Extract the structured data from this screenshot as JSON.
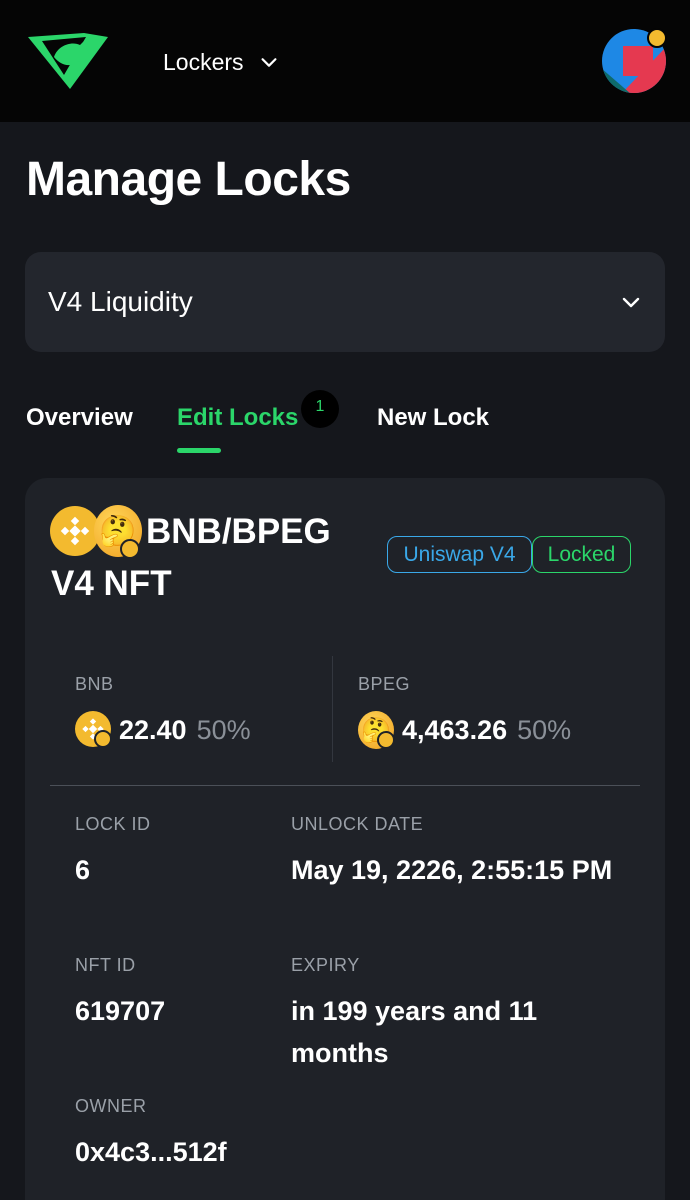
{
  "nav": {
    "dropdown_label": "Lockers"
  },
  "page": {
    "title": "Manage Locks"
  },
  "lock_type_select": {
    "value": "V4 Liquidity"
  },
  "tabs": [
    {
      "label": "Overview",
      "active": false
    },
    {
      "label": "Edit Locks",
      "active": true,
      "count": "1"
    },
    {
      "label": "New Lock",
      "active": false
    }
  ],
  "lock_card": {
    "pair": "BNB/BPEG",
    "subtitle": "V4 NFT",
    "badges": {
      "protocol": "Uniswap V4",
      "status": "Locked"
    },
    "tokens": [
      {
        "symbol": "BNB",
        "amount": "22.40",
        "percent": "50%"
      },
      {
        "symbol": "BPEG",
        "amount": "4,463.26",
        "percent": "50%"
      }
    ],
    "details": {
      "lock_id_label": "LOCK ID",
      "lock_id": "6",
      "unlock_date_label": "UNLOCK DATE",
      "unlock_date": "May 19, 2226, 2:55:15 PM",
      "nft_id_label": "NFT ID",
      "nft_id": "619707",
      "expiry_label": "EXPIRY",
      "expiry": "in 199 years and 11 months",
      "owner_label": "OWNER",
      "owner": "0x4c3...512f"
    }
  },
  "colors": {
    "accent_green": "#2bd66a",
    "uniswap_blue": "#3aa8e8",
    "bnb_yellow": "#f3ba2f",
    "background": "#15171c",
    "card": "#1f2228"
  },
  "icons": [
    "unicrypt-logo-icon",
    "chevron-down-icon",
    "wallet-avatar-icon",
    "bnb-coin-icon",
    "bpeg-thinking-coin-icon"
  ]
}
